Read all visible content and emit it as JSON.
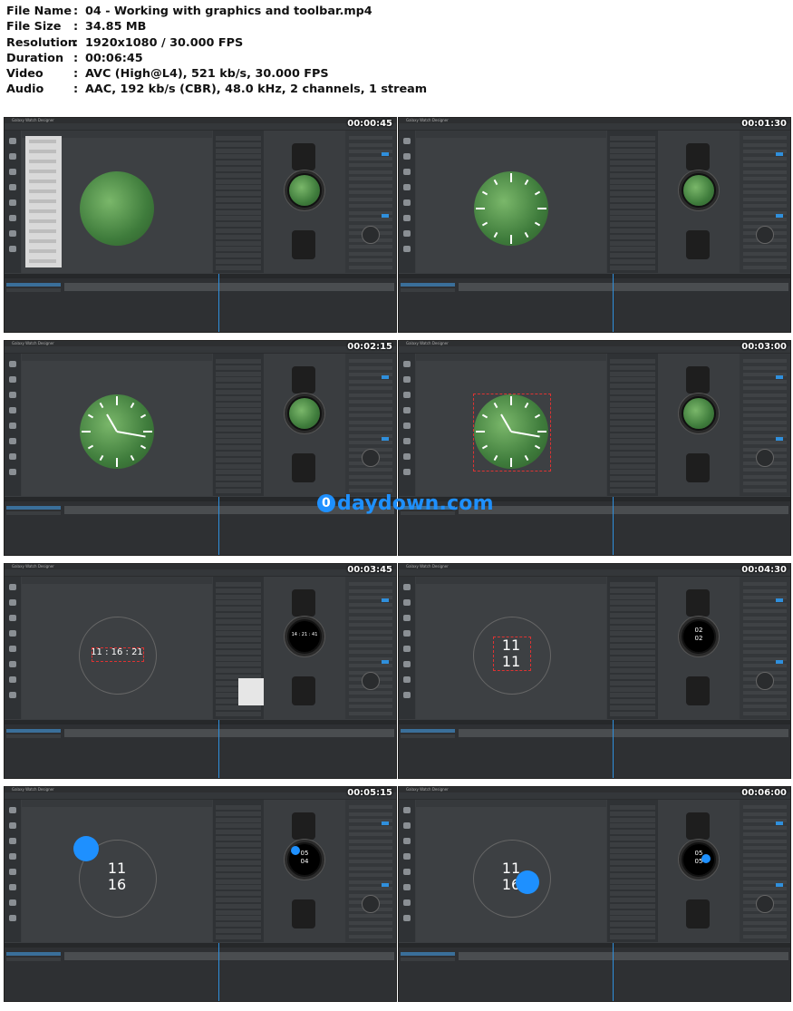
{
  "info": [
    {
      "key": "File Name",
      "sep": ":",
      "value": "04 - Working with graphics and toolbar.mp4"
    },
    {
      "key": "File Size",
      "sep": ":",
      "value": "34.85 MB"
    },
    {
      "key": "Resolution",
      "sep": ":",
      "value": "1920x1080 / 30.000 FPS"
    },
    {
      "key": "Duration",
      "sep": ":",
      "value": "00:06:45"
    },
    {
      "key": "Video",
      "sep": ":",
      "value": "AVC (High@L4), 521 kb/s, 30.000 FPS"
    },
    {
      "key": "Audio",
      "sep": ":",
      "value": "AAC, 192 kb/s (CBR), 48.0 kHz, 2 channels, 1 stream"
    }
  ],
  "app_title": "Galaxy Watch Designer",
  "thumbnails": [
    {
      "timestamp": "00:00:45",
      "kind": "green-menu"
    },
    {
      "timestamp": "00:01:30",
      "kind": "green-ticks"
    },
    {
      "timestamp": "00:02:15",
      "kind": "green-hands"
    },
    {
      "timestamp": "00:03:00",
      "kind": "green-hands-select"
    },
    {
      "timestamp": "00:03:45",
      "kind": "digital-line",
      "digits": "11 : 16 : 21",
      "preview": "14 : 21 : 41"
    },
    {
      "timestamp": "00:04:30",
      "kind": "digital-stack",
      "digits_top": "11",
      "digits_bottom": "11",
      "preview_top": "02",
      "preview_bottom": "02"
    },
    {
      "timestamp": "00:05:15",
      "kind": "digital-dot",
      "digits_top": "11",
      "digits_bottom": "16",
      "preview_top": "05",
      "preview_bottom": "04"
    },
    {
      "timestamp": "00:06:00",
      "kind": "digital-dot-center",
      "digits_top": "11",
      "digits_bottom": "16",
      "preview_top": "05",
      "preview_bottom": "05"
    }
  ],
  "watermark": {
    "text": "daydown.com",
    "mark": "0"
  },
  "colors": {
    "accent": "#2f8fdc",
    "watermark": "#1e90ff",
    "face_green": "#4f8f45"
  }
}
